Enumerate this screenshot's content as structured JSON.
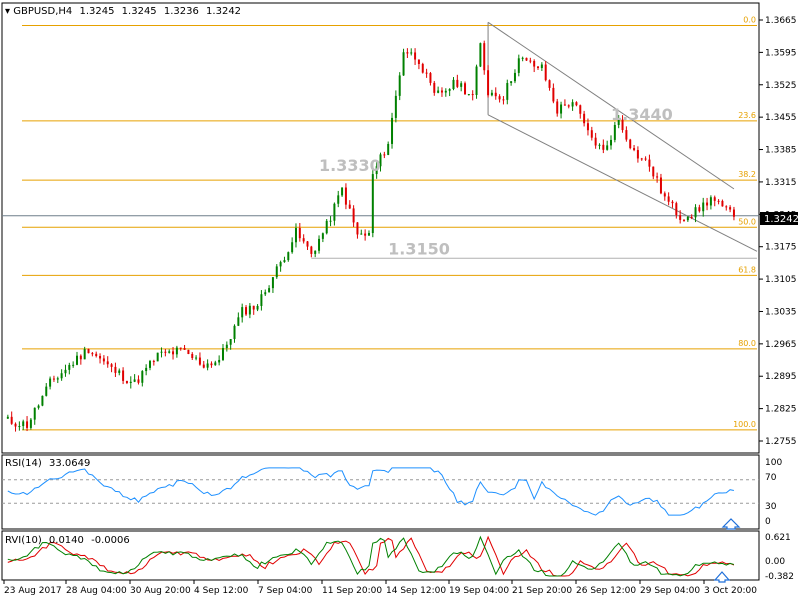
{
  "main_header": {
    "symbol": "GBPUSD,H4",
    "open": "1.3245",
    "high": "1.3245",
    "low": "1.3236",
    "close": "1.3242"
  },
  "colors": {
    "bull_candle": "#008000",
    "bear_candle": "#e00000",
    "fib": "#e6a100",
    "channel": "#808080",
    "bid_line": "#6f7e8a",
    "rsi_line": "#1e90ff",
    "rvi_main": "#008000",
    "rvi_signal": "#e00000",
    "annotation_text": "#bfbfbf"
  },
  "fib_levels": [
    {
      "label": "0.0",
      "price": 1.3653
    },
    {
      "label": "23.6",
      "price": 1.3447
    },
    {
      "label": "38.2",
      "price": 1.3319
    },
    {
      "label": "50.0",
      "price": 1.3217
    },
    {
      "label": "61.8",
      "price": 1.3113
    },
    {
      "label": "80.0",
      "price": 1.2954
    },
    {
      "label": "100.0",
      "price": 1.2779
    }
  ],
  "annotations": [
    {
      "text": "1.3330",
      "x_index": 82,
      "price": 1.333
    },
    {
      "text": "1.3440",
      "x_index": 158,
      "price": 1.344
    },
    {
      "text": "1.3150",
      "x_index": 100,
      "price": 1.315
    }
  ],
  "current_price_label": "1.3242",
  "price_axis_ticks": [
    "1.3665",
    "1.3595",
    "1.3525",
    "1.3455",
    "1.3385",
    "1.3315",
    "1.3245",
    "1.3175",
    "1.3105",
    "1.3035",
    "1.2965",
    "1.2895",
    "1.2825",
    "1.2755"
  ],
  "time_axis_labels": [
    "23 Aug 2017",
    "28 Aug 04:00",
    "30 Aug 20:00",
    "4 Sep 12:00",
    "7 Sep 04:00",
    "11 Sep 20:00",
    "14 Sep 12:00",
    "19 Sep 04:00",
    "21 Sep 20:00",
    "26 Sep 12:00",
    "29 Sep 04:00",
    "3 Oct 20:00"
  ],
  "rsi_panel": {
    "label": "RSI(14)",
    "value": "33.0649",
    "ticks": [
      "100",
      "70",
      "30",
      "0"
    ]
  },
  "rvi_panel": {
    "label": "RVI(10)",
    "main_value": "0.0140",
    "signal_value": "-0.0006",
    "ticks": [
      "0.621",
      "0.00",
      "-0.382"
    ]
  },
  "chart_data": {
    "type": "candlestick",
    "symbol": "GBPUSD",
    "timeframe": "H4",
    "ylim": [
      1.274,
      1.368
    ],
    "x_range": [
      "23 Aug 2017",
      "3 Oct 20:00"
    ],
    "grid": false,
    "price_waypoints": [
      [
        0,
        1.28
      ],
      [
        6,
        1.279
      ],
      [
        12,
        1.288
      ],
      [
        22,
        1.2955
      ],
      [
        28,
        1.291
      ],
      [
        34,
        1.288
      ],
      [
        40,
        1.294
      ],
      [
        46,
        1.295
      ],
      [
        52,
        1.292
      ],
      [
        56,
        1.293
      ],
      [
        62,
        1.3035
      ],
      [
        66,
        1.305
      ],
      [
        72,
        1.314
      ],
      [
        76,
        1.3205
      ],
      [
        80,
        1.316
      ],
      [
        84,
        1.322
      ],
      [
        88,
        1.33
      ],
      [
        92,
        1.32
      ],
      [
        95,
        1.32
      ],
      [
        96,
        1.333
      ],
      [
        100,
        1.34
      ],
      [
        104,
        1.36
      ],
      [
        108,
        1.358
      ],
      [
        112,
        1.35
      ],
      [
        118,
        1.353
      ],
      [
        122,
        1.35
      ],
      [
        124,
        1.361
      ],
      [
        126,
        1.351
      ],
      [
        130,
        1.35
      ],
      [
        134,
        1.358
      ],
      [
        140,
        1.356
      ],
      [
        144,
        1.347
      ],
      [
        148,
        1.349
      ],
      [
        152,
        1.342
      ],
      [
        156,
        1.338
      ],
      [
        160,
        1.345
      ],
      [
        164,
        1.338
      ],
      [
        168,
        1.335
      ],
      [
        172,
        1.328
      ],
      [
        176,
        1.324
      ],
      [
        180,
        1.325
      ],
      [
        184,
        1.328
      ],
      [
        188,
        1.325
      ]
    ],
    "channel_upper": [
      [
        126,
        1.366
      ],
      [
        190,
        1.33
      ]
    ],
    "channel_lower": [
      [
        126,
        1.346
      ],
      [
        196,
        1.3165
      ]
    ],
    "level_1_3150": 1.315,
    "last_price": 1.3242,
    "rsi_value": 33.0649,
    "rsi_levels": [
      70,
      30
    ],
    "rvi_main": 0.014,
    "rvi_signal": -0.0006,
    "rvi_ylim": [
      -0.382,
      0.621
    ]
  }
}
